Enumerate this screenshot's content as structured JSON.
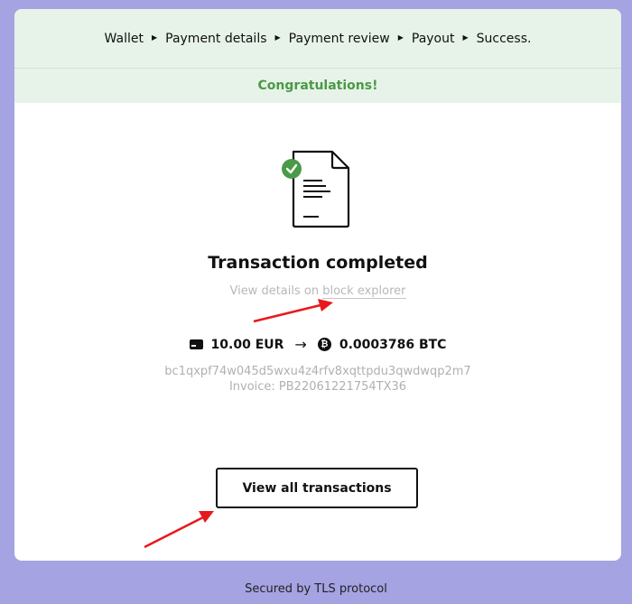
{
  "steps": [
    "Wallet",
    "Payment details",
    "Payment review",
    "Payout",
    "Success."
  ],
  "step_separator": "▶",
  "congrats": "Congratulations!",
  "status": {
    "title": "Transaction completed",
    "details_prefix": "View details on ",
    "details_link": "block explorer"
  },
  "amount": {
    "from": "10.00 EUR",
    "arrow": "→",
    "btc_symbol": "₿",
    "to": "0.0003786 BTC"
  },
  "address": "bc1qxpf74w045d5wxu4z4rfv8xqttpdu3qwdwqp2m7",
  "invoice": "Invoice: PB22061221754TX36",
  "button": {
    "view_all": "View all transactions"
  },
  "footer": "Secured by TLS protocol",
  "colors": {
    "page_background": "#a5a3e2",
    "steps_background": "#e7f3e8",
    "congrats_text": "#4a9a47",
    "check_badge": "#4a9a47",
    "annotation_arrow": "#e8191c"
  }
}
